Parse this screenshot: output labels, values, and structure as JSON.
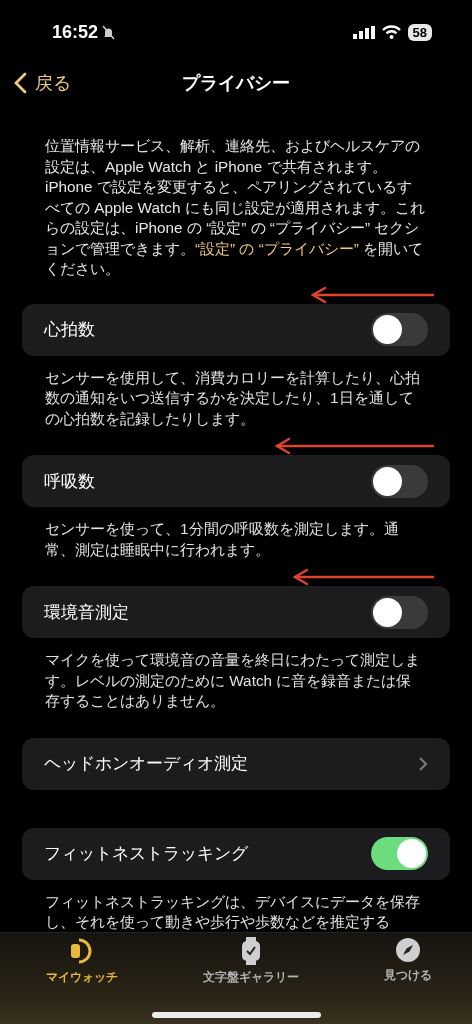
{
  "status_bar": {
    "time": "16:52",
    "battery": "58"
  },
  "nav": {
    "back": "戻る",
    "title": "プライバシー"
  },
  "intro": {
    "text": "位置情報サービス、解析、連絡先、およびヘルスケアの設定は、Apple Watch と iPhone で共有されます。iPhone で設定を変更すると、ペアリングされているすべての Apple Watch にも同じ設定が適用されます。これらの設定は、iPhone の “設定” の “プライバシー” セクションで管理できます。",
    "link": "“設定” の “プライバシー”",
    "text_after": " を開いてください。"
  },
  "sections": [
    {
      "kind": "toggle",
      "label": "心拍数",
      "on": false,
      "description": "センサーを使用して、消費カロリーを計算したり、心拍数の通知をいつ送信するかを決定したり、1日を通しての心拍数を記録したりします。"
    },
    {
      "kind": "toggle",
      "label": "呼吸数",
      "on": false,
      "description": "センサーを使って、1分間の呼吸数を測定します。通常、測定は睡眠中に行われます。"
    },
    {
      "kind": "toggle",
      "label": "環境音測定",
      "on": false,
      "description": "マイクを使って環境音の音量を終日にわたって測定します。レベルの測定のために Watch に音を録音または保存することはありません。"
    },
    {
      "kind": "link",
      "label": "ヘッドホンオーディオ測定"
    },
    {
      "kind": "toggle",
      "label": "フィットネストラッキング",
      "on": true,
      "description": "フィットネストラッキングは、デバイスにデータを保存し、それを使って動きや歩行や歩数などを推定する"
    }
  ],
  "tab_bar": [
    {
      "label": "マイウォッチ",
      "selected": true
    },
    {
      "label": "文字盤ギャラリー",
      "selected": false
    },
    {
      "label": "見つける",
      "selected": false
    }
  ]
}
